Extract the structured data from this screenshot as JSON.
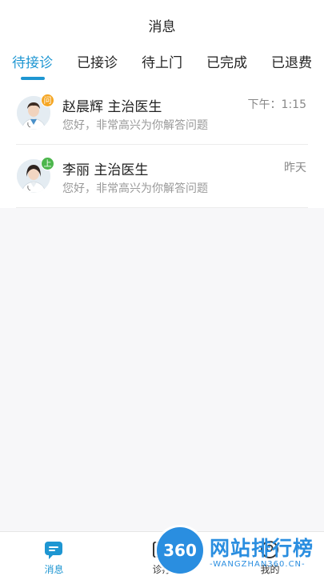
{
  "header": {
    "title": "消息"
  },
  "tabs": [
    {
      "label": "待接诊",
      "active": true
    },
    {
      "label": "已接诊",
      "active": false
    },
    {
      "label": "待上门",
      "active": false
    },
    {
      "label": "已完成",
      "active": false
    },
    {
      "label": "已退费",
      "active": false
    }
  ],
  "messages": [
    {
      "name": "赵晨辉 主治医生",
      "time": "下午：1:15",
      "preview": "您好，非常高兴为你解答问题",
      "badge": "问",
      "badge_color": "#f5a623"
    },
    {
      "name": "李丽 主治医生",
      "time": "昨天",
      "preview": "您好，非常高兴为你解答问题",
      "badge": "上",
      "badge_color": "#4cb64c"
    }
  ],
  "bottom_nav": [
    {
      "label": "消息",
      "icon": "message-icon",
      "active": true
    },
    {
      "label": "诊疗",
      "icon": "clinic-icon",
      "active": false
    },
    {
      "label": "我的",
      "icon": "profile-icon",
      "active": false
    }
  ],
  "watermark": {
    "logo": "360",
    "text": "网站排行榜",
    "sub": "-WANGZHAN360.CN-"
  },
  "colors": {
    "accent": "#1e96d2"
  }
}
